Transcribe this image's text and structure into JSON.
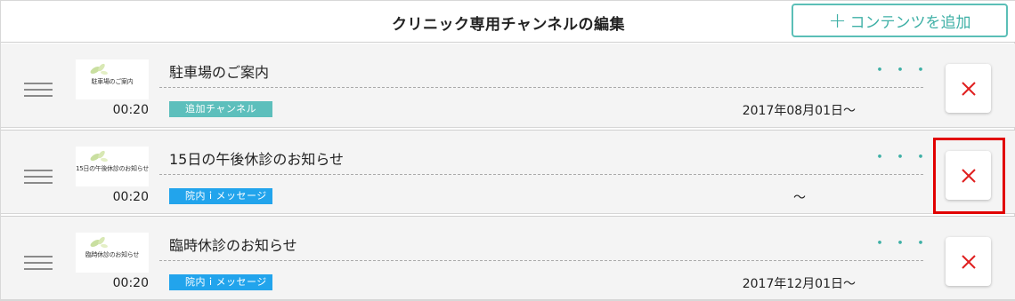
{
  "header": {
    "title": "クリニック専用チャンネルの編集",
    "add_button_icon": "plus-icon",
    "add_button_plus": "+",
    "add_button_label": "コンテンツを追加"
  },
  "colors": {
    "accent_teal": "#3fb0a6",
    "tag_teal": "#5dbfbc",
    "tag_blue": "#22a4ec",
    "delete_red": "#e02020",
    "highlight_red": "#e10000"
  },
  "items": [
    {
      "thumbnail_text": "駐車場のご案内",
      "duration": "00:20",
      "title": "駐車場のご案内",
      "more": "・・・",
      "tag": "追加チャンネル",
      "date": "2017年08月01日〜"
    },
    {
      "thumbnail_text": "15日の午後休診のお知らせ",
      "duration": "00:20",
      "title": "15日の午後休診のお知らせ",
      "more": "・・・",
      "tag": "院内ｉメッセージ",
      "date": "〜"
    },
    {
      "thumbnail_text": "臨時休診のお知らせ",
      "duration": "00:20",
      "title": "臨時休診のお知らせ",
      "more": "・・・",
      "tag": "院内ｉメッセージ",
      "date": "2017年12月01日〜"
    }
  ]
}
